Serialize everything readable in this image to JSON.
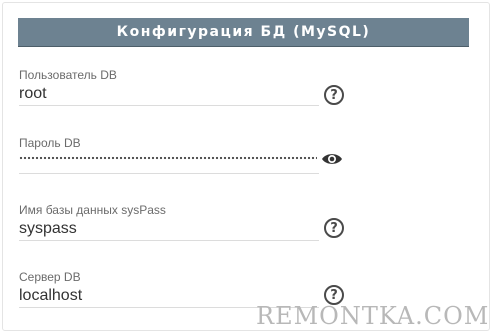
{
  "header": {
    "title": "Конфигурация БД (MySQL)"
  },
  "fields": [
    {
      "label": "Пользователь DB",
      "value": "root"
    },
    {
      "label": "Пароль DB",
      "value": ""
    },
    {
      "label": "Имя базы данных sysPass",
      "value": "syspass"
    },
    {
      "label": "Сервер DB",
      "value": "localhost"
    }
  ],
  "icons": {
    "help": "help-circle-icon",
    "password_toggle": "eye-icon"
  },
  "watermark": "REMONTKA.COM",
  "colors": {
    "header_bg": "#6d8291",
    "header_text": "#ffffff"
  }
}
